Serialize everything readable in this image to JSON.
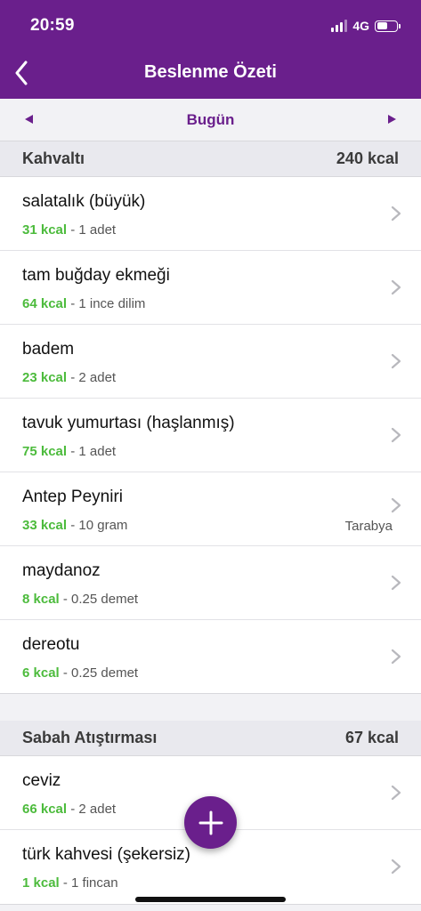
{
  "status_bar": {
    "time": "20:59",
    "network": "4G"
  },
  "nav": {
    "title": "Beslenme Özeti"
  },
  "date_selector": {
    "label": "Bugün"
  },
  "sections": [
    {
      "title": "Kahvaltı",
      "kcal": "240 kcal",
      "items": [
        {
          "name": "salatalık (büyük)",
          "kcal": "31 kcal",
          "portion": " - 1 adet",
          "source": ""
        },
        {
          "name": "tam buğday ekmeği",
          "kcal": "64 kcal",
          "portion": " - 1 ince dilim",
          "source": ""
        },
        {
          "name": "badem",
          "kcal": "23 kcal",
          "portion": " - 2 adet",
          "source": ""
        },
        {
          "name": "tavuk yumurtası (haşlanmış)",
          "kcal": "75 kcal",
          "portion": " - 1 adet",
          "source": ""
        },
        {
          "name": "Antep Peyniri",
          "kcal": "33 kcal",
          "portion": " - 10 gram",
          "source": "Tarabya"
        },
        {
          "name": "maydanoz",
          "kcal": "8 kcal",
          "portion": " - 0.25 demet",
          "source": ""
        },
        {
          "name": "dereotu",
          "kcal": "6 kcal",
          "portion": " - 0.25 demet",
          "source": ""
        }
      ]
    },
    {
      "title": "Sabah Atıştırması",
      "kcal": "67 kcal",
      "items": [
        {
          "name": "ceviz",
          "kcal": "66 kcal",
          "portion": " - 2 adet",
          "source": ""
        },
        {
          "name": "türk kahvesi (şekersiz)",
          "kcal": "1 kcal",
          "portion": " - 1 fincan",
          "source": ""
        }
      ]
    }
  ],
  "icons": {
    "back": "chevron-left-icon",
    "prev": "triangle-left-icon",
    "next": "triangle-right-icon",
    "row": "chevron-right-icon",
    "add": "plus-icon"
  },
  "colors": {
    "brand": "#6a1f8c",
    "kcal": "#4cbb3c"
  },
  "battery_level": 0.5
}
